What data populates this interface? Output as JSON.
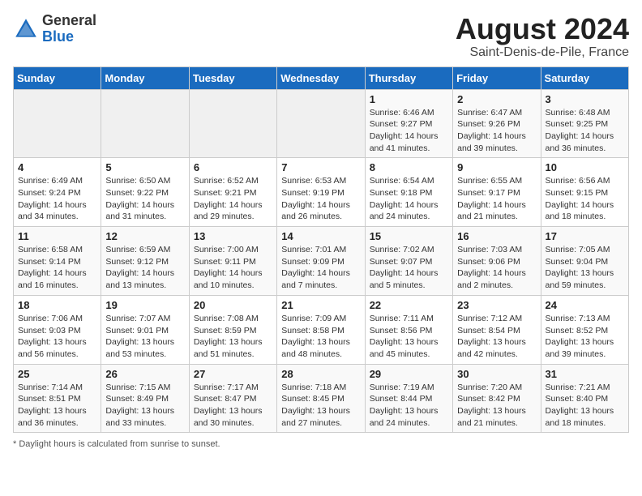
{
  "header": {
    "logo_line1": "General",
    "logo_line2": "Blue",
    "month_year": "August 2024",
    "location": "Saint-Denis-de-Pile, France"
  },
  "days_of_week": [
    "Sunday",
    "Monday",
    "Tuesday",
    "Wednesday",
    "Thursday",
    "Friday",
    "Saturday"
  ],
  "footer": {
    "note": "Daylight hours"
  },
  "weeks": [
    [
      {
        "day": "",
        "empty": true
      },
      {
        "day": "",
        "empty": true
      },
      {
        "day": "",
        "empty": true
      },
      {
        "day": "",
        "empty": true
      },
      {
        "day": "1",
        "sunrise": "6:46 AM",
        "sunset": "9:27 PM",
        "daylight": "14 hours and 41 minutes."
      },
      {
        "day": "2",
        "sunrise": "6:47 AM",
        "sunset": "9:26 PM",
        "daylight": "14 hours and 39 minutes."
      },
      {
        "day": "3",
        "sunrise": "6:48 AM",
        "sunset": "9:25 PM",
        "daylight": "14 hours and 36 minutes."
      }
    ],
    [
      {
        "day": "4",
        "sunrise": "6:49 AM",
        "sunset": "9:24 PM",
        "daylight": "14 hours and 34 minutes."
      },
      {
        "day": "5",
        "sunrise": "6:50 AM",
        "sunset": "9:22 PM",
        "daylight": "14 hours and 31 minutes."
      },
      {
        "day": "6",
        "sunrise": "6:52 AM",
        "sunset": "9:21 PM",
        "daylight": "14 hours and 29 minutes."
      },
      {
        "day": "7",
        "sunrise": "6:53 AM",
        "sunset": "9:19 PM",
        "daylight": "14 hours and 26 minutes."
      },
      {
        "day": "8",
        "sunrise": "6:54 AM",
        "sunset": "9:18 PM",
        "daylight": "14 hours and 24 minutes."
      },
      {
        "day": "9",
        "sunrise": "6:55 AM",
        "sunset": "9:17 PM",
        "daylight": "14 hours and 21 minutes."
      },
      {
        "day": "10",
        "sunrise": "6:56 AM",
        "sunset": "9:15 PM",
        "daylight": "14 hours and 18 minutes."
      }
    ],
    [
      {
        "day": "11",
        "sunrise": "6:58 AM",
        "sunset": "9:14 PM",
        "daylight": "14 hours and 16 minutes."
      },
      {
        "day": "12",
        "sunrise": "6:59 AM",
        "sunset": "9:12 PM",
        "daylight": "14 hours and 13 minutes."
      },
      {
        "day": "13",
        "sunrise": "7:00 AM",
        "sunset": "9:11 PM",
        "daylight": "14 hours and 10 minutes."
      },
      {
        "day": "14",
        "sunrise": "7:01 AM",
        "sunset": "9:09 PM",
        "daylight": "14 hours and 7 minutes."
      },
      {
        "day": "15",
        "sunrise": "7:02 AM",
        "sunset": "9:07 PM",
        "daylight": "14 hours and 5 minutes."
      },
      {
        "day": "16",
        "sunrise": "7:03 AM",
        "sunset": "9:06 PM",
        "daylight": "14 hours and 2 minutes."
      },
      {
        "day": "17",
        "sunrise": "7:05 AM",
        "sunset": "9:04 PM",
        "daylight": "13 hours and 59 minutes."
      }
    ],
    [
      {
        "day": "18",
        "sunrise": "7:06 AM",
        "sunset": "9:03 PM",
        "daylight": "13 hours and 56 minutes."
      },
      {
        "day": "19",
        "sunrise": "7:07 AM",
        "sunset": "9:01 PM",
        "daylight": "13 hours and 53 minutes."
      },
      {
        "day": "20",
        "sunrise": "7:08 AM",
        "sunset": "8:59 PM",
        "daylight": "13 hours and 51 minutes."
      },
      {
        "day": "21",
        "sunrise": "7:09 AM",
        "sunset": "8:58 PM",
        "daylight": "13 hours and 48 minutes."
      },
      {
        "day": "22",
        "sunrise": "7:11 AM",
        "sunset": "8:56 PM",
        "daylight": "13 hours and 45 minutes."
      },
      {
        "day": "23",
        "sunrise": "7:12 AM",
        "sunset": "8:54 PM",
        "daylight": "13 hours and 42 minutes."
      },
      {
        "day": "24",
        "sunrise": "7:13 AM",
        "sunset": "8:52 PM",
        "daylight": "13 hours and 39 minutes."
      }
    ],
    [
      {
        "day": "25",
        "sunrise": "7:14 AM",
        "sunset": "8:51 PM",
        "daylight": "13 hours and 36 minutes."
      },
      {
        "day": "26",
        "sunrise": "7:15 AM",
        "sunset": "8:49 PM",
        "daylight": "13 hours and 33 minutes."
      },
      {
        "day": "27",
        "sunrise": "7:17 AM",
        "sunset": "8:47 PM",
        "daylight": "13 hours and 30 minutes."
      },
      {
        "day": "28",
        "sunrise": "7:18 AM",
        "sunset": "8:45 PM",
        "daylight": "13 hours and 27 minutes."
      },
      {
        "day": "29",
        "sunrise": "7:19 AM",
        "sunset": "8:44 PM",
        "daylight": "13 hours and 24 minutes."
      },
      {
        "day": "30",
        "sunrise": "7:20 AM",
        "sunset": "8:42 PM",
        "daylight": "13 hours and 21 minutes."
      },
      {
        "day": "31",
        "sunrise": "7:21 AM",
        "sunset": "8:40 PM",
        "daylight": "13 hours and 18 minutes."
      }
    ]
  ]
}
